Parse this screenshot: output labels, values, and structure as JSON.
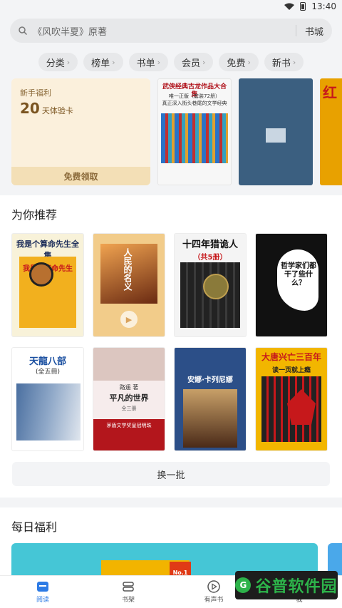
{
  "status": {
    "time": "13:40"
  },
  "search": {
    "placeholder": "《风吹半夏》原著",
    "store_label": "书城"
  },
  "categories": [
    {
      "label": "分类"
    },
    {
      "label": "榜单"
    },
    {
      "label": "书单"
    },
    {
      "label": "会员"
    },
    {
      "label": "免费"
    },
    {
      "label": "新书"
    }
  ],
  "welfare": {
    "title": "新手福利",
    "number": "20",
    "unit": "天体验卡",
    "button": "免费领取"
  },
  "promo_books": {
    "b1_title": "武侠经典古龙作品大合集",
    "b1_line2": "唯一正版（套装72册）",
    "b1_line3": "真正深入街头巷尾的文学经典",
    "b3_title": "红"
  },
  "recommend": {
    "title": "为你推荐",
    "books": [
      {
        "title": "我是个算命先生全集",
        "inner": "我是个算命先生"
      },
      {
        "title": "人民的名义"
      },
      {
        "title": "十四年猎诡人",
        "sub": "（共5册）",
        "spine": "十四年猎诡人"
      },
      {
        "title": "哲学家们都干了些什么？"
      },
      {
        "title": "天龍八部",
        "sub": "(全五冊)"
      },
      {
        "author": "路遥 著",
        "title": "平凡的世界",
        "sub": "全三册",
        "band1": "茅盾文学奖皇冠明珠"
      },
      {
        "title": "安娜·卡列尼娜"
      },
      {
        "title": "大唐兴亡三百年",
        "sub": "读一页就上瘾"
      }
    ],
    "refresh": "换一批"
  },
  "daily": {
    "title": "每日福利",
    "badge": "No.1"
  },
  "tabs": [
    {
      "label": "阅读",
      "icon": "read-icon",
      "active": true
    },
    {
      "label": "书架",
      "icon": "bookshelf-icon"
    },
    {
      "label": "有声书",
      "icon": "audiobook-icon"
    },
    {
      "label": "我",
      "icon": "profile-icon"
    }
  ],
  "watermark": "谷普软件园",
  "colors": {
    "accent": "#2d7be5",
    "welfare_bg": "#fbf0dc",
    "banner": "#45c6d6"
  }
}
